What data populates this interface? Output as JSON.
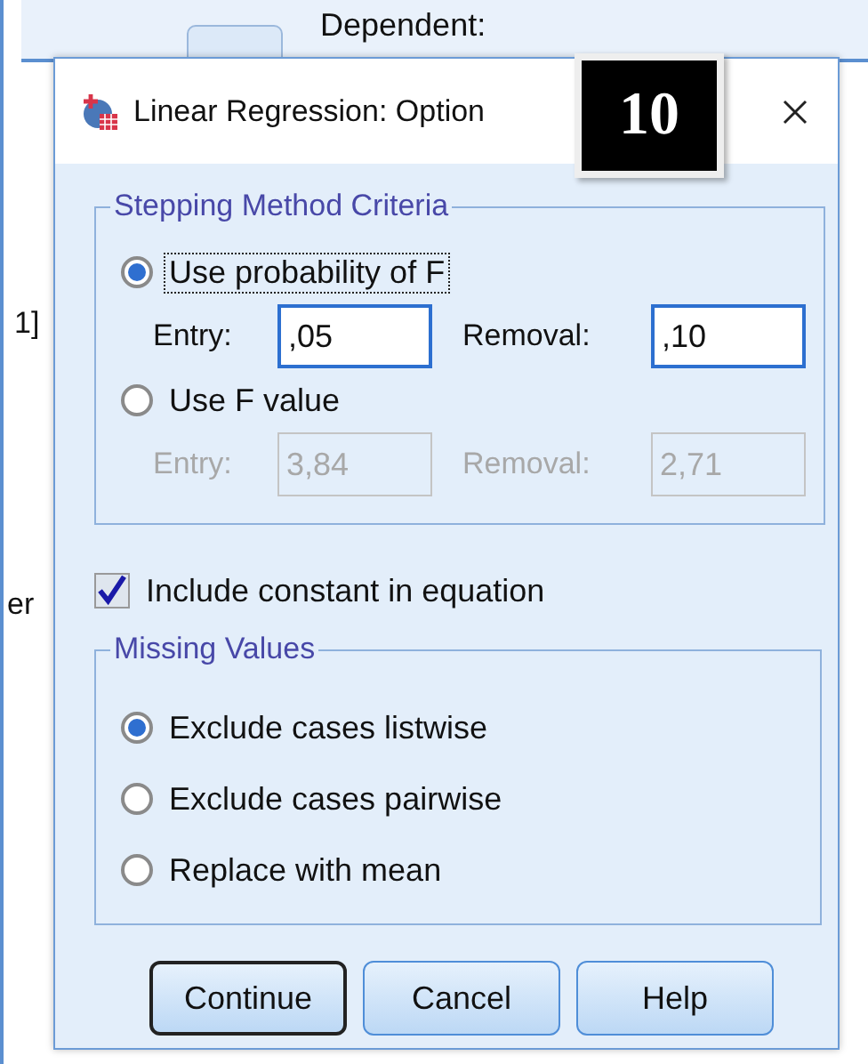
{
  "background_window": {
    "label": "Dependent:",
    "edge_texts": [
      "1]",
      "er"
    ]
  },
  "dialog": {
    "title": "Linear Regression: Option"
  },
  "step_badge": "10",
  "stepping_group": {
    "title": "Stepping Method Criteria",
    "options": [
      {
        "label": "Use probability of F",
        "selected": true,
        "focused": true,
        "fields": [
          {
            "label": "Entry:",
            "value": ",05",
            "disabled": false
          },
          {
            "label": "Removal:",
            "value": ",10",
            "disabled": false
          }
        ]
      },
      {
        "label": "Use F value",
        "selected": false,
        "focused": false,
        "fields": [
          {
            "label": "Entry:",
            "value": "3,84",
            "disabled": true
          },
          {
            "label": "Removal:",
            "value": "2,71",
            "disabled": true
          }
        ]
      }
    ]
  },
  "include_constant": {
    "label": "Include constant in equation",
    "checked": true
  },
  "missing_group": {
    "title": "Missing Values",
    "options": [
      {
        "label": "Exclude cases listwise",
        "selected": true
      },
      {
        "label": "Exclude cases pairwise",
        "selected": false
      },
      {
        "label": "Replace with mean",
        "selected": false
      }
    ]
  },
  "buttons": [
    {
      "label": "Continue",
      "default": true
    },
    {
      "label": "Cancel",
      "default": false
    },
    {
      "label": "Help",
      "default": false
    }
  ]
}
